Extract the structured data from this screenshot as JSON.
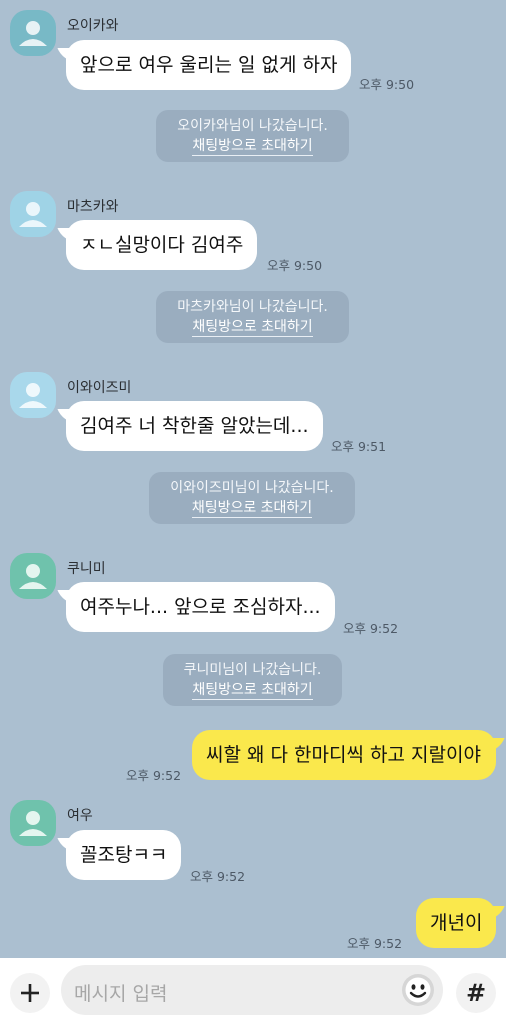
{
  "messages": [
    {
      "sender": "오이카와",
      "text": "앞으로 여우 울리는 일 없게 하자",
      "time": "오후 9:50"
    },
    {
      "sender": "마츠카와",
      "text": "ㅈㄴ실망이다 김여주",
      "time": "오후 9:50"
    },
    {
      "sender": "이와이즈미",
      "text": "김여주 너 착한줄 알았는데...",
      "time": "오후 9:51"
    },
    {
      "sender": "쿠니미",
      "text": "여주누나... 앞으로 조심하자...",
      "time": "오후 9:52"
    },
    {
      "text": "씨할 왜 다 한마디씩 하고 지랄이야",
      "time": "오후 9:52"
    },
    {
      "sender": "여우",
      "text": "꼴조탕ㅋㅋ",
      "time": "오후 9:52"
    },
    {
      "text": "개년이",
      "time": "오후 9:52"
    }
  ],
  "system": [
    {
      "text": "오이카와님이 나갔습니다.",
      "invite": "채팅방으로 초대하기"
    },
    {
      "text": "마츠카와님이 나갔습니다.",
      "invite": "채팅방으로 초대하기"
    },
    {
      "text": "이와이즈미님이 나갔습니다.",
      "invite": "채팅방으로 초대하기"
    },
    {
      "text": "쿠니미님이 나갔습니다.",
      "invite": "채팅방으로 초대하기"
    }
  ],
  "input": {
    "placeholder": "메시지 입력",
    "hash_label": "#"
  },
  "icons": {
    "add": "plus-icon",
    "emoji": "emoticon-icon",
    "hash": "hash-icon",
    "avatar": "default-profile-icon"
  },
  "colors": {
    "background": "#abbfd0",
    "my_bubble": "#fae84c",
    "other_bubble": "#ffffff"
  }
}
